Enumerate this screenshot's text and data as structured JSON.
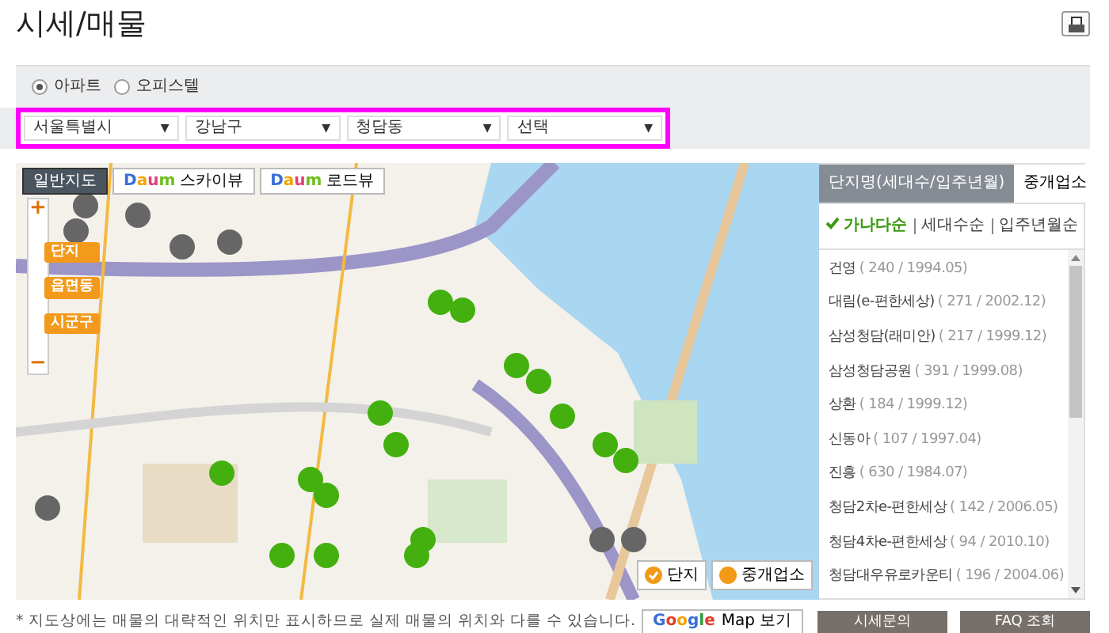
{
  "title": "시세/매물",
  "property_types": [
    {
      "label": "아파트",
      "selected": true
    },
    {
      "label": "오피스텔",
      "selected": false
    }
  ],
  "selects": [
    {
      "value": "서울특별시",
      "caret": "▼"
    },
    {
      "value": "강남구",
      "caret": "▼"
    },
    {
      "value": "청담동",
      "caret": "▼"
    },
    {
      "value": "선택",
      "caret": "▼"
    }
  ],
  "map": {
    "map_types": [
      {
        "kind": "plain",
        "label": "일반지도",
        "selected": true
      },
      {
        "kind": "logo",
        "logo": "Daum",
        "label": "스카이뷰",
        "selected": false
      },
      {
        "kind": "logo",
        "logo": "Daum",
        "label": "로드뷰",
        "selected": false
      }
    ],
    "zoom": {
      "plus": "+",
      "minus": "−",
      "levels": [
        "단지",
        "읍면동",
        "시군구"
      ]
    },
    "legend": [
      {
        "label": "단지",
        "checked": true
      },
      {
        "label": "중개업소",
        "checked": false
      }
    ]
  },
  "panel": {
    "tabs": [
      {
        "label": "단지명(세대수/입주년월)",
        "selected": true
      },
      {
        "label": "중개업소",
        "selected": false
      }
    ],
    "sorts": [
      {
        "label": "가나다순",
        "selected": true
      },
      {
        "label": "세대수순",
        "selected": false
      },
      {
        "label": "입주년월순",
        "selected": false
      }
    ],
    "items": [
      {
        "name": "건영",
        "detail": "( 240 / 1994.05)"
      },
      {
        "name": "대림(e-편한세상)",
        "detail": "( 271 / 2002.12)"
      },
      {
        "name": "삼성청담(래미안)",
        "detail": "( 217 / 1999.12)"
      },
      {
        "name": "삼성청담공원",
        "detail": "( 391 / 1999.08)"
      },
      {
        "name": "상환",
        "detail": "( 184 / 1999.12)"
      },
      {
        "name": "신동아",
        "detail": "( 107 / 1997.04)"
      },
      {
        "name": "진흥",
        "detail": "( 630 / 1984.07)"
      },
      {
        "name": "청담2차e-편한세상",
        "detail": "( 142 / 2006.05)"
      },
      {
        "name": "청담4차e-편한세상",
        "detail": "( 94 / 2010.10)"
      },
      {
        "name": "청담대우유로카운티",
        "detail": "( 196 / 2004.06)"
      }
    ]
  },
  "footer": {
    "note": "* 지도상에는 매물의 대략적인 위치만 표시하므로 실제 매물의 위치와 다를 수 있습니다.",
    "google_logo": "Google",
    "google_label": "Map 보기",
    "buttons": [
      "시세문의",
      "FAQ 조회"
    ]
  }
}
